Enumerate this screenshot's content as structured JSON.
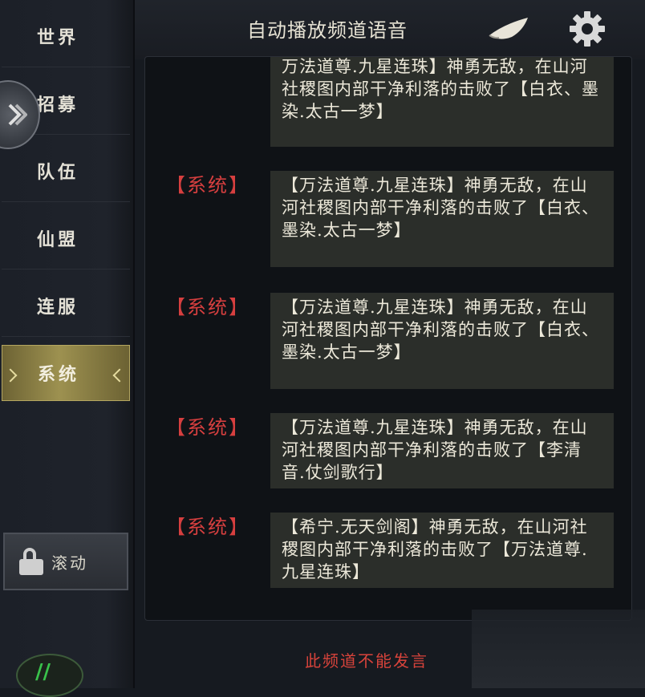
{
  "sidebar": {
    "items": [
      {
        "label": "世界"
      },
      {
        "label": "招募"
      },
      {
        "label": "队伍"
      },
      {
        "label": "仙盟"
      },
      {
        "label": "连服"
      },
      {
        "label": "系统"
      }
    ],
    "active_index": 5,
    "scroll_label": "滚动"
  },
  "header": {
    "title": "自动播放频道语音"
  },
  "messages": [
    {
      "tag": "",
      "text": "万法道尊.九星连珠】神勇无敌，在山河社稷图内部干净利落的击败了【白衣、墨染.太古一梦】"
    },
    {
      "tag": "【系统】",
      "text": "【万法道尊.九星连珠】神勇无敌，在山河社稷图内部干净利落的击败了【白衣、墨染.太古一梦】"
    },
    {
      "tag": "【系统】",
      "text": "【万法道尊.九星连珠】神勇无敌，在山河社稷图内部干净利落的击败了【白衣、墨染.太古一梦】"
    },
    {
      "tag": "【系统】",
      "text": "【万法道尊.九星连珠】神勇无敌，在山河社稷图内部干净利落的击败了【李清音.仗剑歌行】"
    },
    {
      "tag": "【系统】",
      "text": "【希宁.无天剑阁】神勇无敌，在山河社稷图内部干净利落的击败了【万法道尊.九星连珠】"
    }
  ],
  "footer": {
    "note": "此频道不能发言"
  },
  "colors": {
    "system_tag": "#d63f3f",
    "active_tab": "#9d9150"
  }
}
